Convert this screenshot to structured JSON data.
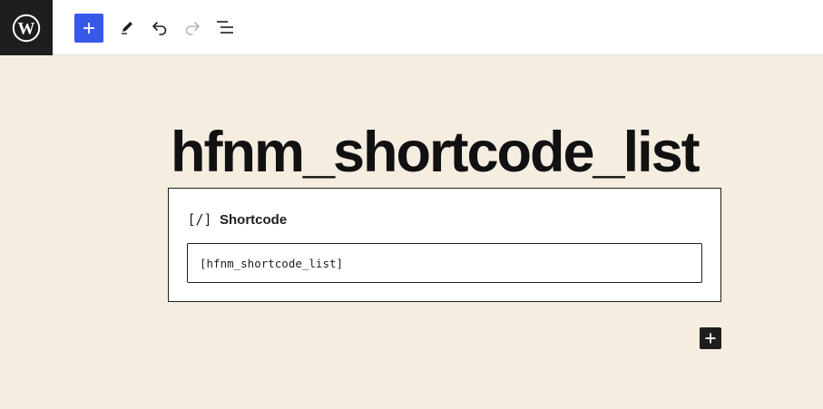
{
  "toolbar": {
    "logo_icon": "wordpress-logo-icon",
    "buttons": [
      {
        "name": "inserter-button",
        "icon": "plus-icon",
        "color": "#3858e9"
      },
      {
        "name": "tools-button",
        "icon": "pencil-icon"
      },
      {
        "name": "undo-button",
        "icon": "undo-icon"
      },
      {
        "name": "redo-button",
        "icon": "redo-icon",
        "state": "disabled"
      },
      {
        "name": "list-view-button",
        "icon": "list-view-icon"
      }
    ]
  },
  "post": {
    "title": "hfnm_shortcode_list"
  },
  "shortcode_block": {
    "icon_glyph": "[/]",
    "label": "Shortcode",
    "value": "[hfnm_shortcode_list]"
  },
  "appender": {
    "icon": "plus-icon"
  },
  "colors": {
    "canvas_background": "#f5ede0",
    "toolbar_background": "#ffffff",
    "logo_background": "#1e1e1e",
    "accent": "#3858e9",
    "text": "#111111"
  }
}
